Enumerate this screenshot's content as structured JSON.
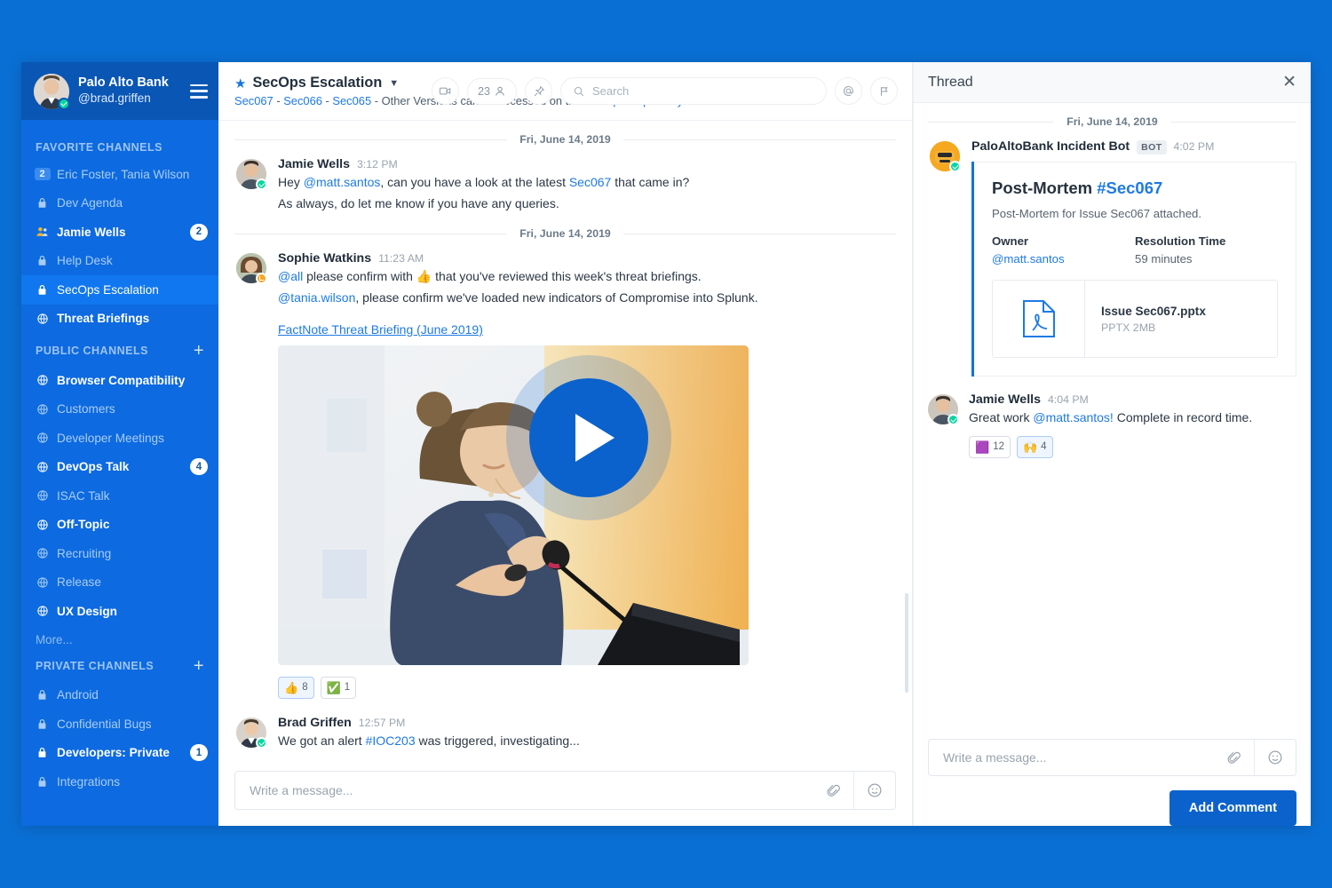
{
  "theme": {
    "page_bg": "#0a6fd4",
    "sidebar_bg": "#0d6ae0",
    "sidebar_header_bg": "#0a56b4",
    "sidebar_active_bg": "#1177f0",
    "accent": "#1e7ae4",
    "button_blue": "#0b62cc",
    "online_green": "#06d6a0",
    "away_orange": "#f5a623"
  },
  "sidebar": {
    "team_name": "Palo Alto Bank",
    "user_handle": "@brad.griffen",
    "menu_icon": "hamburger-icon",
    "sections": [
      {
        "title": "FAVORITE CHANNELS",
        "has_add": false,
        "items": [
          {
            "label": "Eric Foster, Tania Wilson",
            "icon": "member-count-badge",
            "count": "2",
            "count_style": "square",
            "state": "muted"
          },
          {
            "label": "Dev Agenda",
            "icon": "lock-icon",
            "state": "muted"
          },
          {
            "label": "Jamie Wells",
            "icon": "people-icon",
            "count": "2",
            "count_style": "pill",
            "state": "unread"
          },
          {
            "label": "Help Desk",
            "icon": "lock-icon",
            "state": "muted"
          },
          {
            "label": "SecOps Escalation",
            "icon": "lock-icon",
            "state": "active"
          },
          {
            "label": "Threat Briefings",
            "icon": "globe-icon",
            "state": "unread"
          }
        ]
      },
      {
        "title": "PUBLIC CHANNELS",
        "has_add": true,
        "add_label": "+",
        "items": [
          {
            "label": "Browser Compatibility",
            "icon": "globe-icon",
            "state": "unread"
          },
          {
            "label": "Customers",
            "icon": "globe-icon",
            "state": "muted"
          },
          {
            "label": "Developer Meetings",
            "icon": "globe-icon",
            "state": "muted"
          },
          {
            "label": "DevOps Talk",
            "icon": "globe-icon",
            "count": "4",
            "count_style": "pill",
            "state": "unread"
          },
          {
            "label": "ISAC Talk",
            "icon": "globe-icon",
            "state": "muted"
          },
          {
            "label": "Off-Topic",
            "icon": "globe-icon",
            "state": "unread"
          },
          {
            "label": "Recruiting",
            "icon": "globe-icon",
            "state": "muted"
          },
          {
            "label": "Release",
            "icon": "globe-icon",
            "state": "muted"
          },
          {
            "label": "UX Design",
            "icon": "globe-icon",
            "state": "unread"
          }
        ],
        "more_label": "More..."
      },
      {
        "title": "PRIVATE CHANNELS",
        "has_add": true,
        "add_label": "+",
        "items": [
          {
            "label": "Android",
            "icon": "lock-icon",
            "state": "muted"
          },
          {
            "label": "Confidential Bugs",
            "icon": "lock-icon",
            "state": "muted"
          },
          {
            "label": "Developers: Private",
            "icon": "lock-icon",
            "count": "1",
            "count_style": "pill",
            "state": "unread"
          },
          {
            "label": "Integrations",
            "icon": "lock-icon",
            "state": "muted"
          }
        ]
      }
    ]
  },
  "channel_header": {
    "star_icon": "star-icon",
    "title": "SecOps Escalation",
    "chevron_icon": "chevron-down-icon",
    "subtitle_links": [
      "Sec067",
      "Sec066",
      "Sec065"
    ],
    "subtitle_text": " - Other Versions can be accessed on the ",
    "subtitle_repo_link": "SecOps Repository",
    "subtitle_tail": ".",
    "video_icon": "video-camera-icon",
    "member_count": "23",
    "member_icon": "person-icon",
    "pin_icon": "pin-icon",
    "search_placeholder": "Search",
    "search_value": "",
    "search_icon": "search-icon",
    "mention_icon": "at-mention-icon",
    "flag_icon": "flag-icon"
  },
  "messages": {
    "day_sep_1": "Fri, June 14, 2019",
    "day_sep_2": "Fri, June 14, 2019",
    "items": [
      {
        "author": "Jamie Wells",
        "time": "3:12 PM",
        "presence": "online",
        "line1_a": "Hey ",
        "line1_mention": "@matt.santos",
        "line1_b": ", can you have a look at the latest ",
        "line1_link": "Sec067",
        "line1_c": " that came in?",
        "line2": "As always, do let me know if you have any queries."
      },
      {
        "author": "Sophie Watkins",
        "time": "11:23 AM",
        "presence": "away",
        "line1_mention": "@all",
        "line1_a": " please confirm with ",
        "line1_emoji": "👍",
        "line1_b": " that you've reviewed this week's threat briefings.",
        "line2_mention": "@tania.wilson",
        "line2_b": ", please confirm we've loaded new indicators of Compromise into Splunk.",
        "attachment_link": "FactNote Threat Briefing (June 2019)",
        "video_alt": "woman-speaking-at-podium",
        "play_icon": "play-button-icon",
        "reactions": [
          {
            "emoji": "👍",
            "count": "8",
            "active": true
          },
          {
            "emoji": "✅",
            "count": "1",
            "active": false
          }
        ]
      },
      {
        "author": "Brad Griffen",
        "time": "12:57 PM",
        "presence": "online",
        "line1_a": "We got an alert ",
        "line1_link": "#IOC203",
        "line1_b": " was triggered, investigating..."
      }
    ]
  },
  "composer": {
    "placeholder": "Write a message...",
    "value": "",
    "attach_icon": "paperclip-icon",
    "emoji_icon": "emoji-smiley-icon"
  },
  "thread": {
    "title": "Thread",
    "close_icon": "close-icon",
    "day_sep": "Fri, June 14, 2019",
    "bot_message": {
      "author": "PaloAltoBank Incident Bot",
      "bot_tag": "BOT",
      "time": "4:02 PM",
      "presence": "online",
      "card": {
        "title_main": "Post-Mortem ",
        "title_hash": "#Sec067",
        "subtitle": "Post-Mortem for Issue Sec067 attached.",
        "fields": [
          {
            "key": "Owner",
            "value": "@matt.santos",
            "is_link": true
          },
          {
            "key": "Resolution Time",
            "value": "59 minutes",
            "is_link": false
          }
        ],
        "file": {
          "icon": "pdf-file-icon",
          "name": "Issue Sec067.pptx",
          "size": "PPTX 2MB"
        }
      }
    },
    "reply": {
      "author": "Jamie Wells",
      "time": "4:04 PM",
      "presence": "online",
      "line_a": "Great work ",
      "line_mention": "@matt.santos!",
      "line_b": " Complete in record time.",
      "reactions": [
        {
          "emoji": "🟪",
          "count": "12",
          "active": false
        },
        {
          "emoji": "🙌",
          "count": "4",
          "active": true
        }
      ]
    },
    "composer": {
      "placeholder": "Write a message...",
      "value": "",
      "attach_icon": "paperclip-icon",
      "emoji_icon": "emoji-smiley-icon"
    },
    "add_comment_label": "Add Comment"
  }
}
